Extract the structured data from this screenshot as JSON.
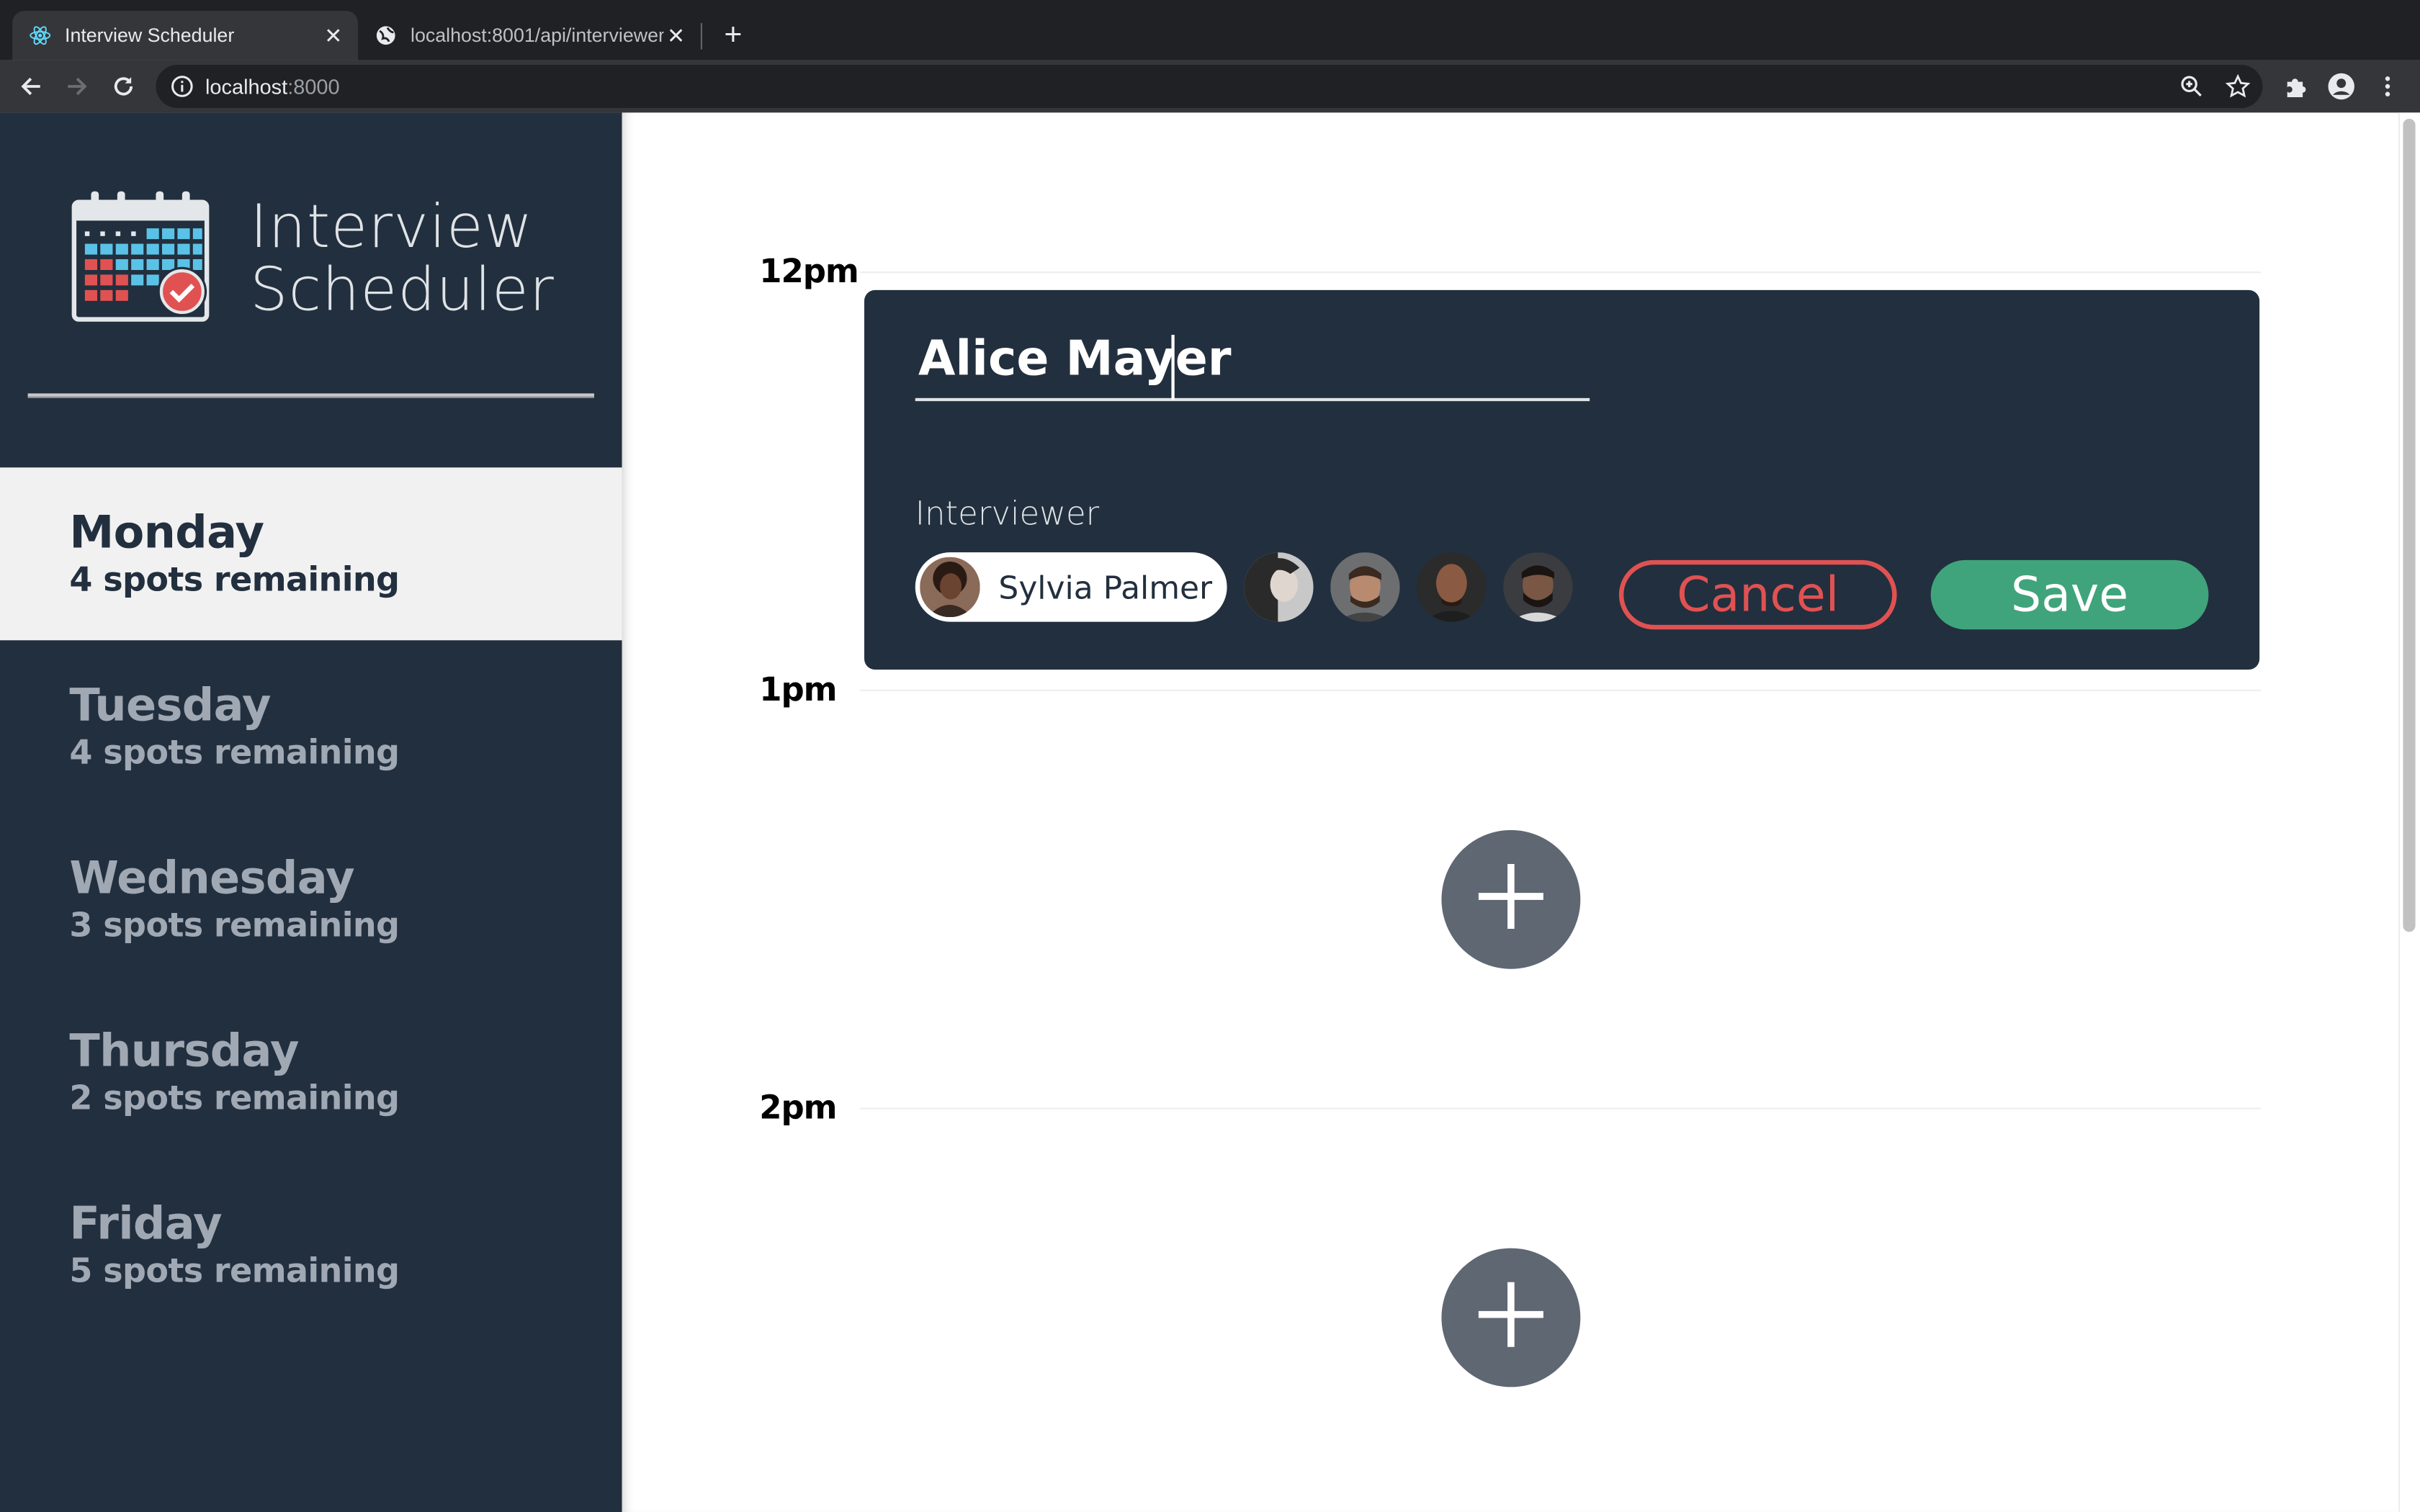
{
  "browser": {
    "tabs": [
      {
        "title": "Interview Scheduler",
        "icon": "react-icon",
        "active": true
      },
      {
        "title": "localhost:8001/api/interviewers",
        "icon": "globe-icon",
        "active": false
      }
    ],
    "url_host": "localhost",
    "url_port": ":8000"
  },
  "sidebar": {
    "brand_line1": "Interview",
    "brand_line2": "Scheduler",
    "days": [
      {
        "name": "Monday",
        "spots": "4 spots remaining",
        "selected": true
      },
      {
        "name": "Tuesday",
        "spots": "4 spots remaining",
        "selected": false
      },
      {
        "name": "Wednesday",
        "spots": "3 spots remaining",
        "selected": false
      },
      {
        "name": "Thursday",
        "spots": "2 spots remaining",
        "selected": false
      },
      {
        "name": "Friday",
        "spots": "5 spots remaining",
        "selected": false
      }
    ]
  },
  "schedule": {
    "times": [
      "12pm",
      "1pm",
      "2pm"
    ],
    "form": {
      "student_name": "Alice Mayer",
      "interviewer_label": "Interviewer",
      "selected_interviewer": "Sylvia Palmer",
      "cancel_label": "Cancel",
      "save_label": "Save"
    }
  },
  "colors": {
    "sidebar_bg": "#222f3e",
    "cancel": "#e05252",
    "save": "#3fa47b",
    "add_button": "#5f6773"
  }
}
